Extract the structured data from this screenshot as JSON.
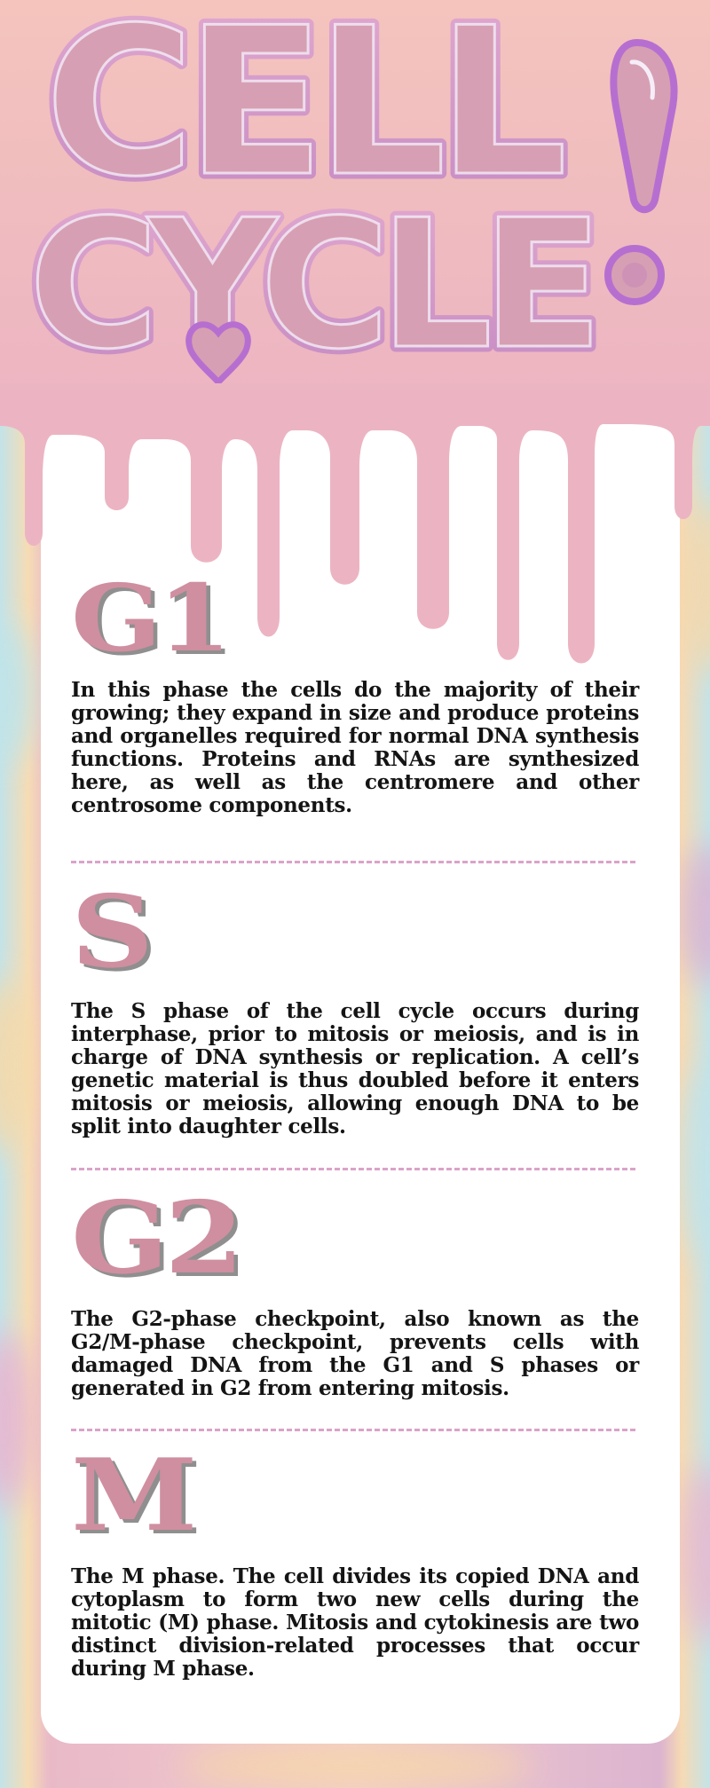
{
  "title": {
    "line1": "CELL",
    "line2": "CYCLE",
    "mark": "!"
  },
  "phases": [
    {
      "heading": "G1",
      "text": "In this phase the cells do the majority of their growing; they expand in size and produce proteins and organelles required for normal DNA synthesis functions. Proteins and RNAs are synthesized here, as well as the centromere and other centrosome components."
    },
    {
      "heading": "S",
      "text": "The S phase of the cell cycle occurs during interphase, prior to mitosis or meiosis, and is in charge of DNA synthesis or replication. A cell’s genetic material is thus doubled before it enters mitosis or meiosis, allowing enough DNA to be split into daughter cells."
    },
    {
      "heading": "G2",
      "text": "The G2-phase checkpoint, also known as the G2/M-phase checkpoint, prevents cells with damaged DNA from the G1 and S phases or generated in G2 from entering mitosis."
    },
    {
      "heading": "M",
      "text": "The M phase. The cell divides its copied DNA and cytoplasm to form two new cells during the mitotic (M) phase. Mitosis and cytokinesis are two distinct division-related processes that occur during M phase."
    }
  ],
  "colors": {
    "header_pink": "#f0bcbf",
    "heading_pink": "#cf8fa0",
    "bubble_stroke": "#b66fd0",
    "divider": "#d9a3c9"
  }
}
